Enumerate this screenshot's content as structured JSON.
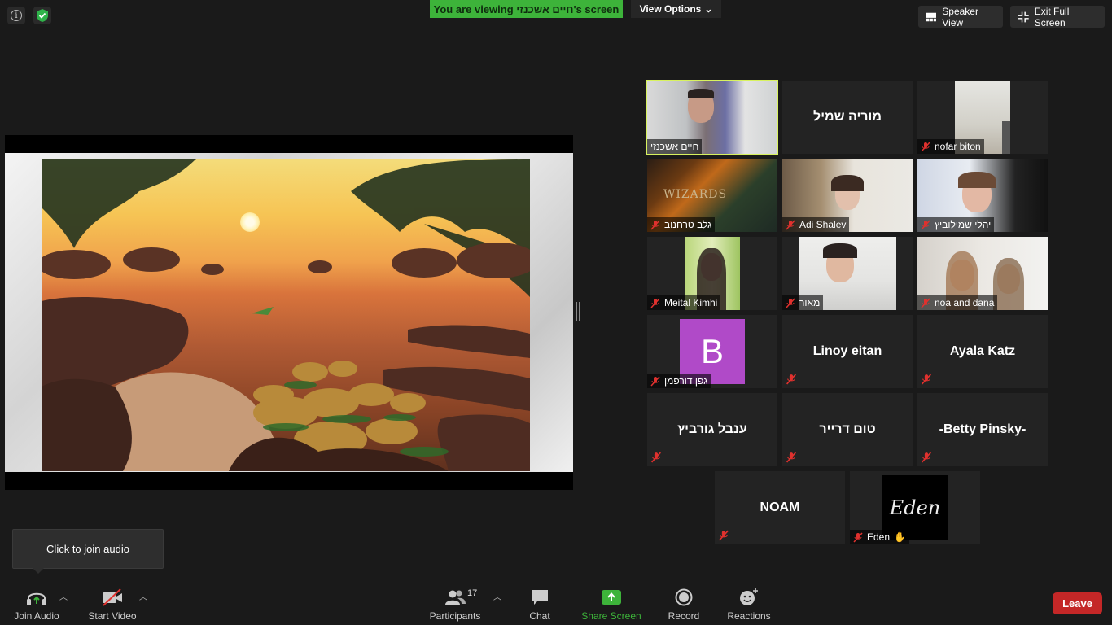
{
  "top": {
    "banner_prefix": "You are viewing",
    "banner_name": "חיים אשכנזי's screen",
    "view_options": "View Options",
    "speaker_view": "Speaker View",
    "exit_full_screen": "Exit Full Screen"
  },
  "gallery": [
    {
      "name": "חיים אשכנזי",
      "video": true,
      "muted": false,
      "active": true
    },
    {
      "name": "מוריה שמיל",
      "video": false,
      "muted": false
    },
    {
      "name": "nofar biton",
      "video": true,
      "muted": true
    },
    {
      "name": "גלב טרחנוב",
      "video": true,
      "muted": true
    },
    {
      "name": "Adi Shalev",
      "video": true,
      "muted": true
    },
    {
      "name": "יהלי שמילוביץ",
      "video": true,
      "muted": true
    },
    {
      "name": "Meital Kimhi",
      "video": true,
      "muted": true
    },
    {
      "name": "מאור",
      "video": true,
      "muted": true
    },
    {
      "name": "noa and dana",
      "video": true,
      "muted": true
    },
    {
      "name": "גפן דורפמן",
      "video": false,
      "muted": true,
      "avatar_letter": "B"
    },
    {
      "name": "Linoy eitan",
      "video": false,
      "muted": true
    },
    {
      "name": "Ayala Katz",
      "video": false,
      "muted": true
    },
    {
      "name": "ענבל גורביץ",
      "video": false,
      "muted": true
    },
    {
      "name": "טום דרייר",
      "video": false,
      "muted": true
    },
    {
      "name": "-Betty Pinsky-",
      "video": false,
      "muted": true
    },
    {
      "name": "NOAM",
      "video": false,
      "muted": true
    },
    {
      "name": "Eden",
      "video": false,
      "muted": true,
      "avatar_text": "Eden"
    }
  ],
  "tooltip": "Click to join audio",
  "toolbar": {
    "join_audio": "Join Audio",
    "start_video": "Start Video",
    "participants": "Participants",
    "participants_count": "17",
    "chat": "Chat",
    "share_screen": "Share Screen",
    "record": "Record",
    "reactions": "Reactions",
    "leave": "Leave"
  },
  "colors": {
    "share_green": "#3db33a",
    "active_speaker": "#d8f25f",
    "leave_red": "#c42727",
    "muted_red": "#e0312e",
    "avatar_purple": "#b04ac8"
  }
}
